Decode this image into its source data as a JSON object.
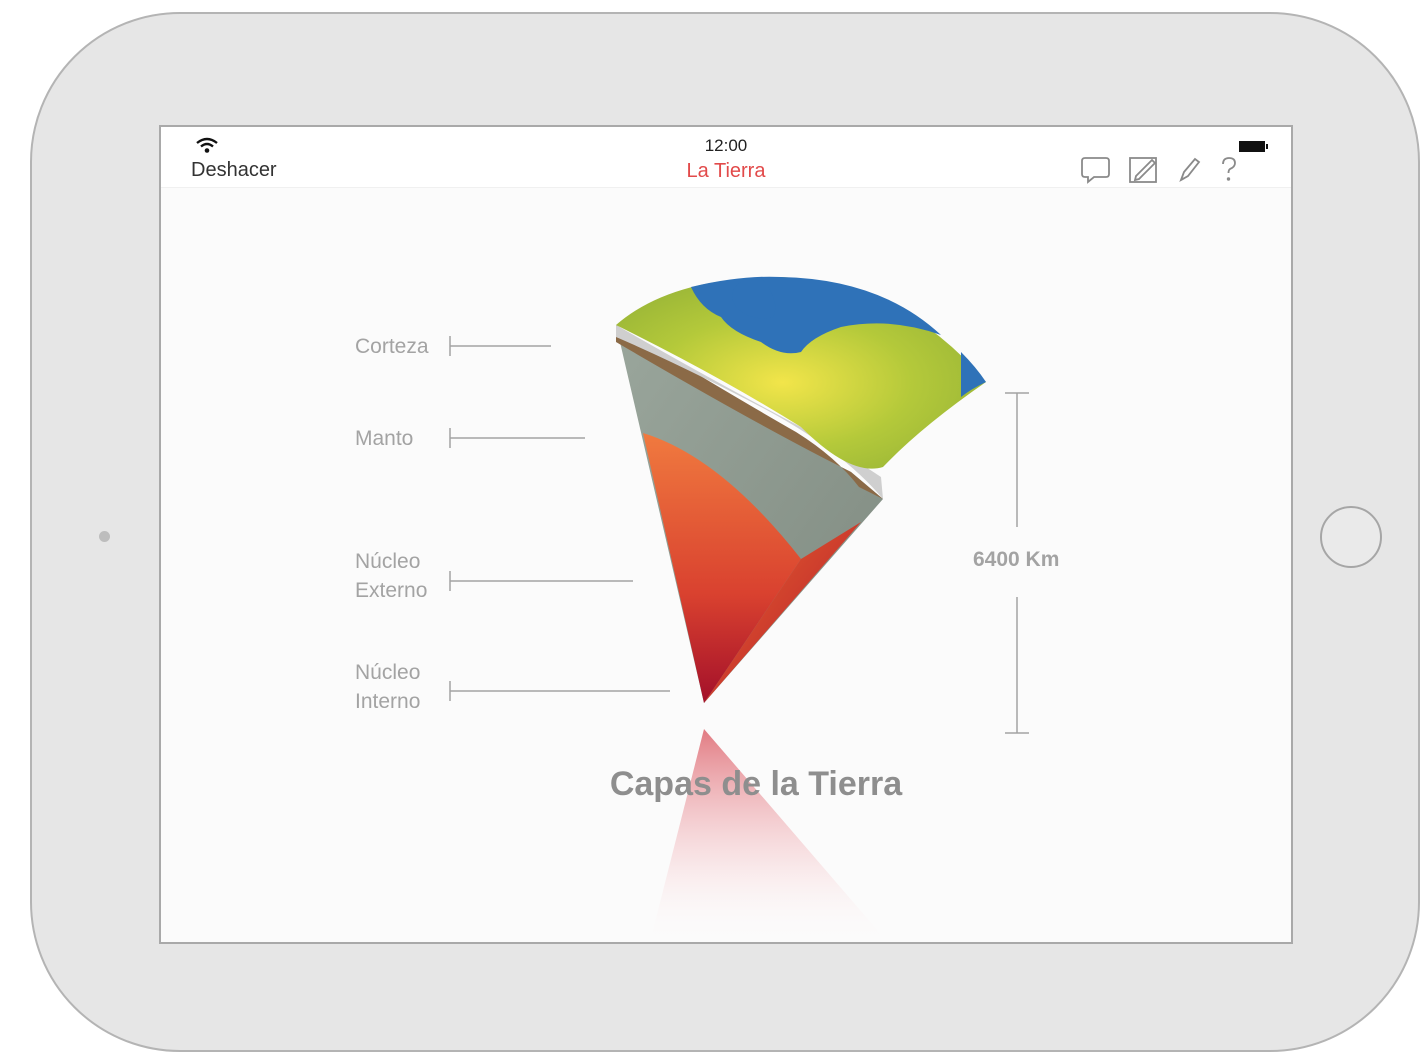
{
  "status_bar": {
    "time": "12:00"
  },
  "nav": {
    "undo_label": "Deshacer",
    "title": "La Tierra",
    "tools": [
      "comment-icon",
      "edit-box-icon",
      "pencil-icon",
      "help-icon"
    ]
  },
  "diagram": {
    "labels": {
      "crust": "Corteza",
      "mantle": "Manto",
      "outer_core": "Núcleo\nExterno",
      "inner_core": "Núcleo\nInterno"
    },
    "radius_label": "6400 Km",
    "title": "Capas de la Tierra"
  },
  "colors": {
    "title_accent": "#e24a4a",
    "ocean": "#2f72b8",
    "land": "#b4c93a",
    "mantle": "#8f9a90",
    "core": "#d9412f",
    "label_gray": "#a3a3a3"
  }
}
